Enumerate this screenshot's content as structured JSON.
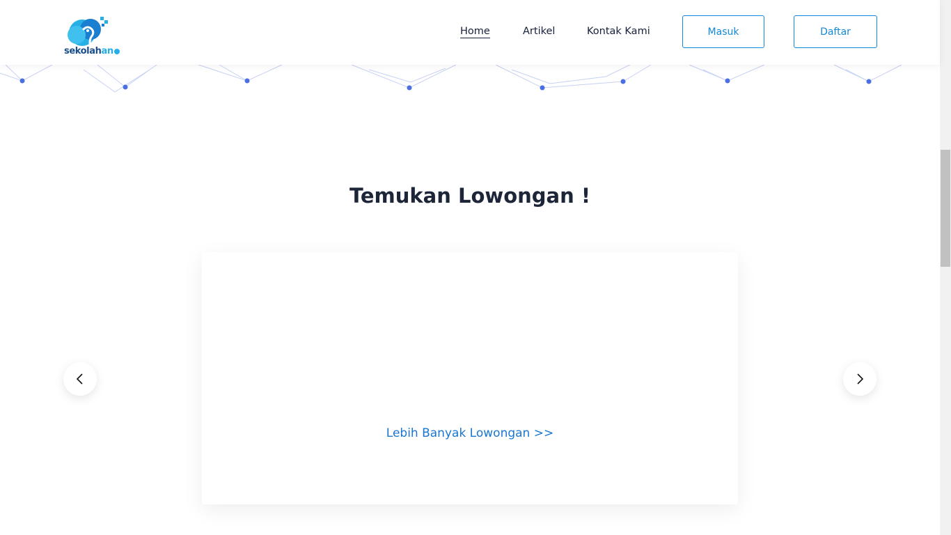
{
  "brand": {
    "name_main": "sekolah",
    "name_accent": "an"
  },
  "nav": {
    "links": [
      {
        "label": "Home",
        "active": true
      },
      {
        "label": "Artikel",
        "active": false
      },
      {
        "label": "Kontak Kami",
        "active": false
      }
    ],
    "login_label": "Masuk",
    "register_label": "Daftar"
  },
  "main": {
    "heading": "Temukan Lowongan !",
    "more_jobs_label": "Lebih Banyak Lowongan >>"
  },
  "icons": {
    "logo": "elephant-cloud-logo",
    "prev": "chevron-left-icon",
    "next": "chevron-right-icon"
  },
  "colors": {
    "accent": "#1488d8",
    "link": "#1976d2",
    "logo_blue": "#26b0e6",
    "network_dot": "#4a6fe0"
  }
}
